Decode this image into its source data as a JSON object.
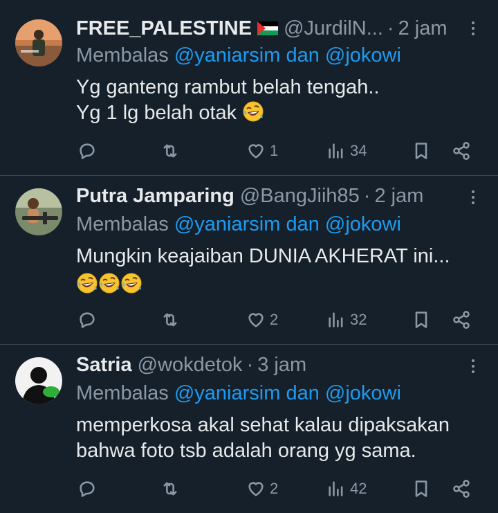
{
  "tweets": [
    {
      "name": "FREE_PALESTINE",
      "handle": "@JurdilN...",
      "dot": "·",
      "time": "2 jam",
      "reply_prefix": "Membalas",
      "reply_user1": "@yaniarsim",
      "reply_and": "dan",
      "reply_user2": "@jokowi",
      "text_line1": "Yg ganteng rambut belah tengah..",
      "text_line2": "Yg 1 lg belah otak",
      "emoji": "rolling-on-floor-laughing",
      "replies": "",
      "retweets": "",
      "likes": "1",
      "views": "34"
    },
    {
      "name": "Putra Jamparing",
      "handle": "@BangJiih85",
      "dot": "·",
      "time": "2 jam",
      "reply_prefix": "Membalas",
      "reply_user1": "@yaniarsim",
      "reply_and": "dan",
      "reply_user2": "@jokowi",
      "text_line1": "Mungkin keajaiban DUNIA AKHERAT ini...",
      "emoji": "rolling-on-floor-laughing",
      "emoji_count": 3,
      "replies": "",
      "retweets": "",
      "likes": "2",
      "views": "32"
    },
    {
      "name": "Satria",
      "handle": "@wokdetok",
      "dot": "·",
      "time": "3 jam",
      "reply_prefix": "Membalas",
      "reply_user1": "@yaniarsim",
      "reply_and": "dan",
      "reply_user2": "@jokowi",
      "text_line1": "memperkosa akal sehat kalau dipaksakan",
      "text_line2": "bahwa foto tsb adalah orang yg sama.",
      "replies": "",
      "retweets": "",
      "likes": "2",
      "views": "42"
    }
  ],
  "colors": {
    "background": "#15202b",
    "text": "#e7e9ea",
    "muted": "#8b98a5",
    "link": "#1d9bf0",
    "divider": "#38444d"
  },
  "icons": [
    "reply-icon",
    "retweet-icon",
    "like-icon",
    "views-icon",
    "bookmark-icon",
    "share-icon",
    "more-icon",
    "palestine-flag-icon"
  ]
}
